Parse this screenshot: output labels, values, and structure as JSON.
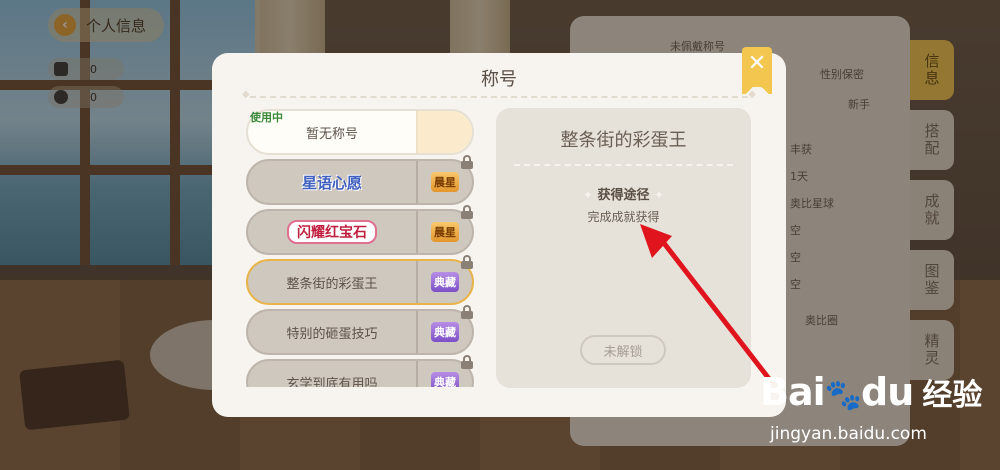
{
  "header": {
    "back_label": "个人信息",
    "stats": [
      "0",
      "0"
    ]
  },
  "modal": {
    "title": "称号",
    "titles": [
      {
        "name": "暂无称号",
        "status": "使用中",
        "badge": ""
      },
      {
        "name": "星语心愿",
        "badge": "晨星"
      },
      {
        "name": "闪耀红宝石",
        "badge": "晨星"
      },
      {
        "name": "整条街的彩蛋王",
        "badge": "典藏"
      },
      {
        "name": "特别的砸蛋技巧",
        "badge": "典藏"
      },
      {
        "name": "玄学到底有用吗",
        "badge": "典藏"
      }
    ],
    "detail": {
      "title": "整条街的彩蛋王",
      "obtain_label": "获得途径",
      "obtain_desc": "完成成就获得",
      "unlock_button": "未解锁"
    }
  },
  "profile": {
    "title_hint": "未佩戴称号",
    "gender": "性别保密",
    "level": "新手",
    "rows": [
      "丰获",
      "1天",
      "奥比星球",
      "空",
      "空",
      "空"
    ],
    "circle": "奥比圈"
  },
  "side_tabs": [
    "信息",
    "搭配",
    "成就",
    "图鉴",
    "精灵"
  ],
  "watermark": {
    "brand_left": "Bai",
    "brand_right": "du",
    "brand_text": "经验",
    "url": "jingyan.baidu.com"
  },
  "colors": {
    "accent": "#f3c64f",
    "annotation_arrow": "#e0141c"
  }
}
